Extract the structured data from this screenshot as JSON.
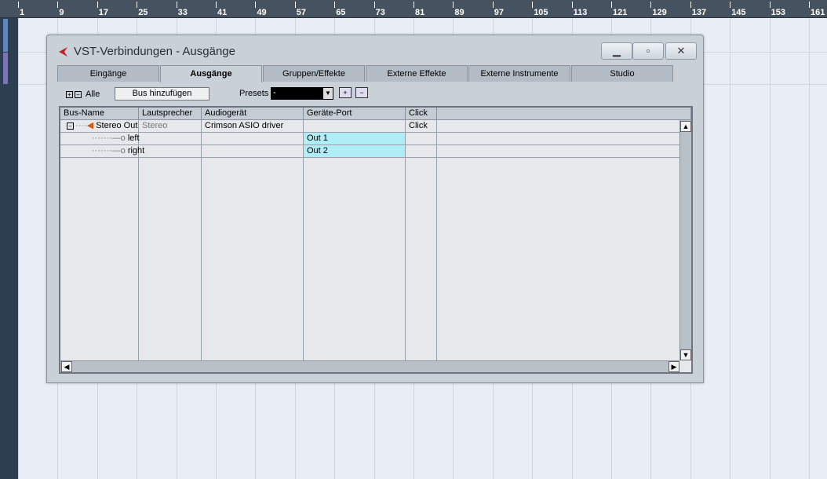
{
  "ruler": {
    "ticks": [
      "1",
      "9",
      "17",
      "25",
      "33",
      "41",
      "49",
      "57",
      "65",
      "73",
      "81",
      "89",
      "97",
      "105",
      "113",
      "121",
      "129",
      "137",
      "145",
      "153",
      "161"
    ]
  },
  "dialog": {
    "title": "VST-Verbindungen - Ausgänge",
    "minimize": "▁",
    "maximize": "▫",
    "close": "✕"
  },
  "tabs": [
    {
      "label": "Eingänge"
    },
    {
      "label": "Ausgänge",
      "active": true
    },
    {
      "label": "Gruppen/Effekte"
    },
    {
      "label": "Externe Effekte"
    },
    {
      "label": "Externe Instrumente"
    },
    {
      "label": "Studio"
    }
  ],
  "toolbar": {
    "expand": "+",
    "collapse": "−",
    "all_label": "Alle",
    "add_bus": "Bus hinzufügen",
    "presets_label": "Presets",
    "presets_value": "-"
  },
  "table": {
    "columns": [
      "Bus-Name",
      "Lautsprecher",
      "Audiogerät",
      "Geräte-Port",
      "Click"
    ],
    "rows": [
      {
        "name": "Stereo Out",
        "speaker": "Stereo",
        "device": "Crimson ASIO driver",
        "port": "",
        "click": "Click"
      },
      {
        "name": "left",
        "speaker": "",
        "device": "",
        "port": "Out 1",
        "click": ""
      },
      {
        "name": "right",
        "speaker": "",
        "device": "",
        "port": "Out 2",
        "click": ""
      }
    ]
  },
  "colors": {
    "port_highlight": "#b0eef7",
    "ruler": "#46525f"
  }
}
